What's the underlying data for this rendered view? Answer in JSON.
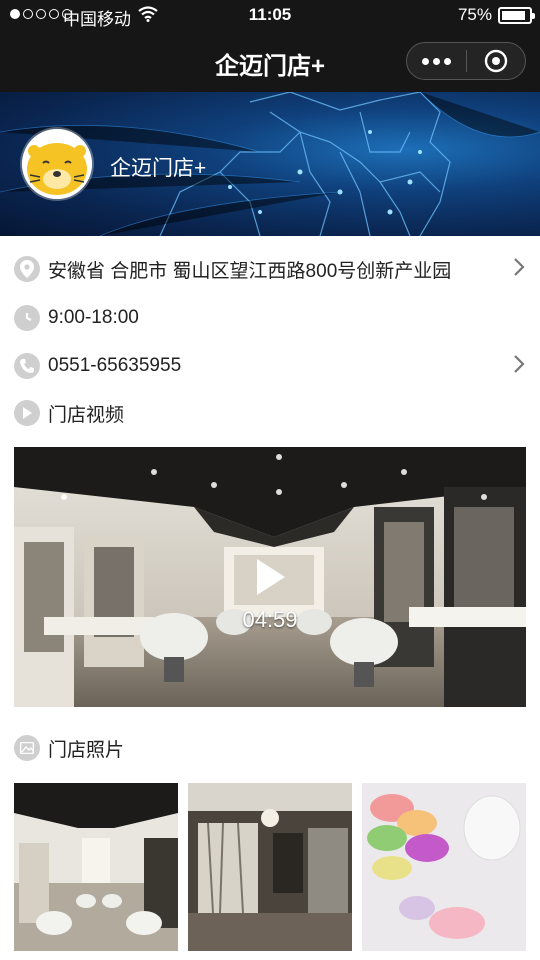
{
  "status_bar": {
    "carrier": "中国移动",
    "time": "11:05",
    "battery": "75%",
    "battery_level": 0.75,
    "signal_bars_filled": 1,
    "signal_bars_total": 5
  },
  "nav": {
    "title": "企迈门店+",
    "more_icon": "more-dots-icon",
    "close_icon": "target-close-icon"
  },
  "store": {
    "name": "企迈门店+",
    "avatar_icon": "otter-avatar",
    "address": "安徽省 合肥市 蜀山区望江西路800号创新产业园",
    "hours": "9:00-18:00",
    "phone": "0551-65635955"
  },
  "sections": {
    "video_title": "门店视频",
    "photos_title": "门店照片"
  },
  "video": {
    "duration": "04:59"
  },
  "colors": {
    "bar_bg": "#161616",
    "icon_gray": "#cfcfcf",
    "banner_blue": "#0f3f7a"
  }
}
